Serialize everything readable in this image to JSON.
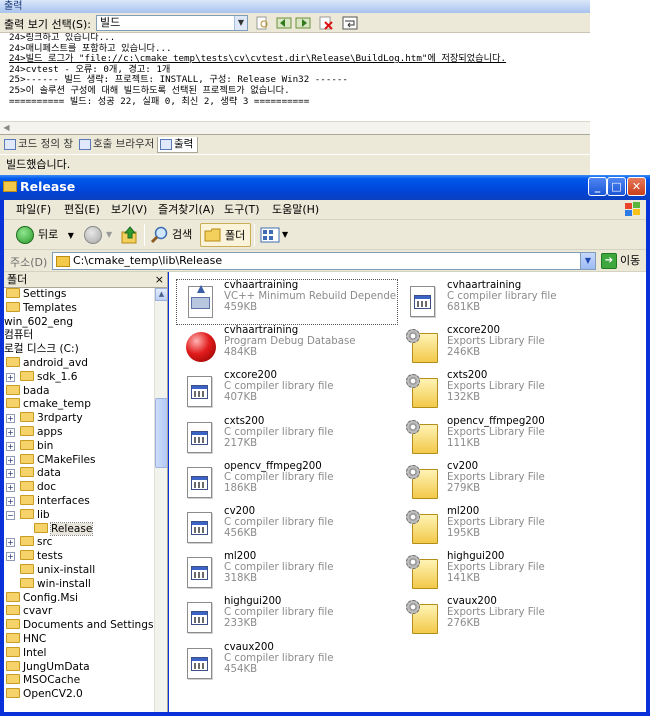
{
  "output_panel": {
    "title": "출력",
    "toolbar_label": "출력 보기 선택(S):",
    "toolbar_select_value": "빌드",
    "lines": [
      "24>링크하고 있습니다...",
      "24>매니페스트를 포함하고 있습니다...",
      "24>빌드 로그가 \"file://c:\\cmake_temp\\tests\\cv\\cvtest.dir\\Release\\BuildLog.htm\"에 저장되었습니다.",
      "24>cvtest - 오류: 0개, 경고: 1개",
      "25>------ 빌드 생략: 프로젝트: INSTALL, 구성: Release Win32 ------",
      "25>이 솔루션 구성에 대해 빌드하도록 선택된 프로젝트가 없습니다.",
      "========== 빌드: 성공 22, 실패 0, 최신 2, 생략 3 =========="
    ],
    "tabs": [
      {
        "label": "코드 정의 창"
      },
      {
        "label": "호출 브라우저"
      },
      {
        "label": "출력"
      }
    ],
    "status": "빌드했습니다."
  },
  "window": {
    "title": "Release",
    "menu": [
      "파일(F)",
      "편집(E)",
      "보기(V)",
      "즐겨찾기(A)",
      "도구(T)",
      "도움말(H)"
    ],
    "toolbar": {
      "back": "뒤로",
      "search": "검색",
      "folders": "폴더"
    },
    "address": {
      "label": "주소(D)",
      "value": "C:\\cmake_temp\\lib\\Release",
      "go": "이동"
    },
    "folder_pane": {
      "title": "폴더",
      "close": "×",
      "nodes": [
        {
          "label": "Settings"
        },
        {
          "label": "Templates"
        },
        {
          "label": "win_602_eng"
        },
        {
          "label": "컴퓨터"
        },
        {
          "label": "로컬 디스크 (C:)"
        },
        {
          "label": "android_avd"
        },
        {
          "label": "sdk_1.6"
        },
        {
          "label": "bada"
        },
        {
          "label": "cmake_temp"
        },
        {
          "label": "3rdparty"
        },
        {
          "label": "apps"
        },
        {
          "label": "bin"
        },
        {
          "label": "CMakeFiles"
        },
        {
          "label": "data"
        },
        {
          "label": "doc"
        },
        {
          "label": "interfaces"
        },
        {
          "label": "lib"
        },
        {
          "label": "Release"
        },
        {
          "label": "src"
        },
        {
          "label": "tests"
        },
        {
          "label": "unix-install"
        },
        {
          "label": "win-install"
        },
        {
          "label": "Config.Msi"
        },
        {
          "label": "cvavr"
        },
        {
          "label": "Documents and Settings"
        },
        {
          "label": "HNC"
        },
        {
          "label": "Intel"
        },
        {
          "label": "JungUmData"
        },
        {
          "label": "MSOCache"
        },
        {
          "label": "OpenCV2.0"
        }
      ]
    },
    "files": [
      {
        "name": "cvhaartraining",
        "type": "VC++ Minimum Rebuild Dependenc...",
        "size": "459KB",
        "icon": "idb-icon"
      },
      {
        "name": "cvhaartraining",
        "type": "C compiler library file",
        "size": "681KB",
        "icon": "lib-file-icon"
      },
      {
        "name": "cvhaartraining",
        "type": "Program Debug Database",
        "size": "484KB",
        "icon": "pdb-icon"
      },
      {
        "name": "cxcore200",
        "type": "Exports Library File",
        "size": "246KB",
        "icon": "exports-file-icon"
      },
      {
        "name": "cxcore200",
        "type": "C compiler library file",
        "size": "407KB",
        "icon": "lib-file-icon"
      },
      {
        "name": "cxts200",
        "type": "Exports Library File",
        "size": "132KB",
        "icon": "exports-file-icon"
      },
      {
        "name": "cxts200",
        "type": "C compiler library file",
        "size": "217KB",
        "icon": "lib-file-icon"
      },
      {
        "name": "opencv_ffmpeg200",
        "type": "Exports Library File",
        "size": "111KB",
        "icon": "exports-file-icon"
      },
      {
        "name": "opencv_ffmpeg200",
        "type": "C compiler library file",
        "size": "186KB",
        "icon": "lib-file-icon"
      },
      {
        "name": "cv200",
        "type": "Exports Library File",
        "size": "279KB",
        "icon": "exports-file-icon"
      },
      {
        "name": "cv200",
        "type": "C compiler library file",
        "size": "456KB",
        "icon": "lib-file-icon"
      },
      {
        "name": "ml200",
        "type": "Exports Library File",
        "size": "195KB",
        "icon": "exports-file-icon"
      },
      {
        "name": "ml200",
        "type": "C compiler library file",
        "size": "318KB",
        "icon": "lib-file-icon"
      },
      {
        "name": "highgui200",
        "type": "Exports Library File",
        "size": "141KB",
        "icon": "exports-file-icon"
      },
      {
        "name": "highgui200",
        "type": "C compiler library file",
        "size": "233KB",
        "icon": "lib-file-icon"
      },
      {
        "name": "cvaux200",
        "type": "Exports Library File",
        "size": "276KB",
        "icon": "exports-file-icon"
      },
      {
        "name": "cvaux200",
        "type": "C compiler library file",
        "size": "454KB",
        "icon": "lib-file-icon"
      }
    ]
  }
}
